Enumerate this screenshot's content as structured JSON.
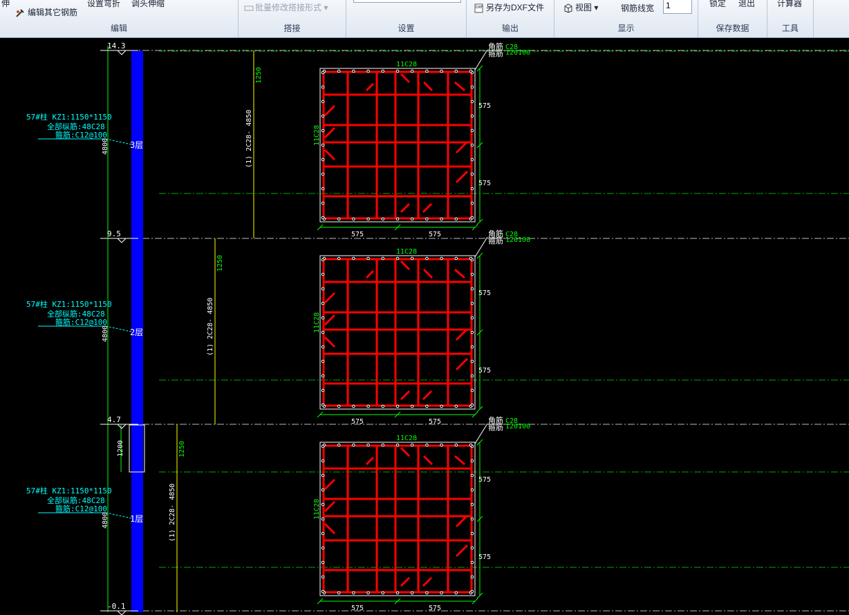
{
  "ribbon": {
    "groups": {
      "edit": {
        "title": "编辑",
        "stretch": "伸",
        "set_bend": "设置弯折",
        "adjust_head": "调头伸缩",
        "edit_other": "编辑其它钢筋"
      },
      "splice": {
        "title": "搭接",
        "batch_modify": "批量修改搭接形式"
      },
      "settings": {
        "title": "设置"
      },
      "output": {
        "title": "输出",
        "save_dxf": "另存为DXF文件"
      },
      "display": {
        "title": "显示",
        "view": "视图",
        "line_width_label": "钢筋线宽",
        "line_width_value": "1"
      },
      "save": {
        "title": "保存数据",
        "lock": "锁定",
        "exit": "退出"
      },
      "tools": {
        "title": "工具",
        "calculator": "计算器"
      }
    }
  },
  "drawing": {
    "elevations": [
      "14.3",
      "9.5",
      "4.7",
      "-0.1"
    ],
    "floors": [
      {
        "floor_label": "3层",
        "col_title": "57#柱 KZ1:1150*1150",
        "col_long": "全部纵筋:48C28",
        "col_stirrup": "箍筋:C12@100",
        "height": "4800",
        "splice_len": "1250",
        "rebar_note": "(1) 2C28- 4850"
      },
      {
        "floor_label": "2层",
        "col_title": "57#柱 KZ1:1150*1150",
        "col_long": "全部纵筋:48C28",
        "col_stirrup": "箍筋:C12@100",
        "height": "4800",
        "splice_len": "1250",
        "rebar_note": "(1) 2C28- 4850"
      },
      {
        "floor_label": "1层",
        "col_title": "57#柱 KZ1:1150*1150",
        "col_long": "全部纵筋:48C28",
        "col_stirrup": "箍筋:C12@100",
        "height": "4800",
        "splice_len": "1250",
        "rebar_note": "(1) 2C28- 4850"
      }
    ],
    "bottom_dense_zone": "1200",
    "sections": [
      {
        "corner_bar": "角筋",
        "corner_spec": "C28",
        "stirrup": "箍筋",
        "stirrup_spec": "120100",
        "top_bars": "11C28",
        "side_bars": "11C28",
        "dim_a": "575",
        "dim_b": "575",
        "dim_c": "575",
        "dim_d": "575"
      },
      {
        "corner_bar": "角筋",
        "corner_spec": "C28",
        "stirrup": "箍筋",
        "stirrup_spec": "120100",
        "top_bars": "11C28",
        "side_bars": "11C28",
        "dim_a": "575",
        "dim_b": "575",
        "dim_c": "575",
        "dim_d": "575"
      },
      {
        "corner_bar": "角筋",
        "corner_spec": "C28",
        "stirrup": "箍筋",
        "stirrup_spec": "120100",
        "top_bars": "11C28",
        "side_bars": "11C28",
        "dim_a": "575",
        "dim_b": "575",
        "dim_c": "575",
        "dim_d": "575"
      }
    ],
    "colors": {
      "column": "#0000ff",
      "rebar": "#ff0000",
      "label_cyan": "#00ffff",
      "label_green": "#00ff00",
      "dim_white": "#ffffff",
      "axis_yellow": "#ffff00",
      "center_line": "#00aa00"
    }
  }
}
